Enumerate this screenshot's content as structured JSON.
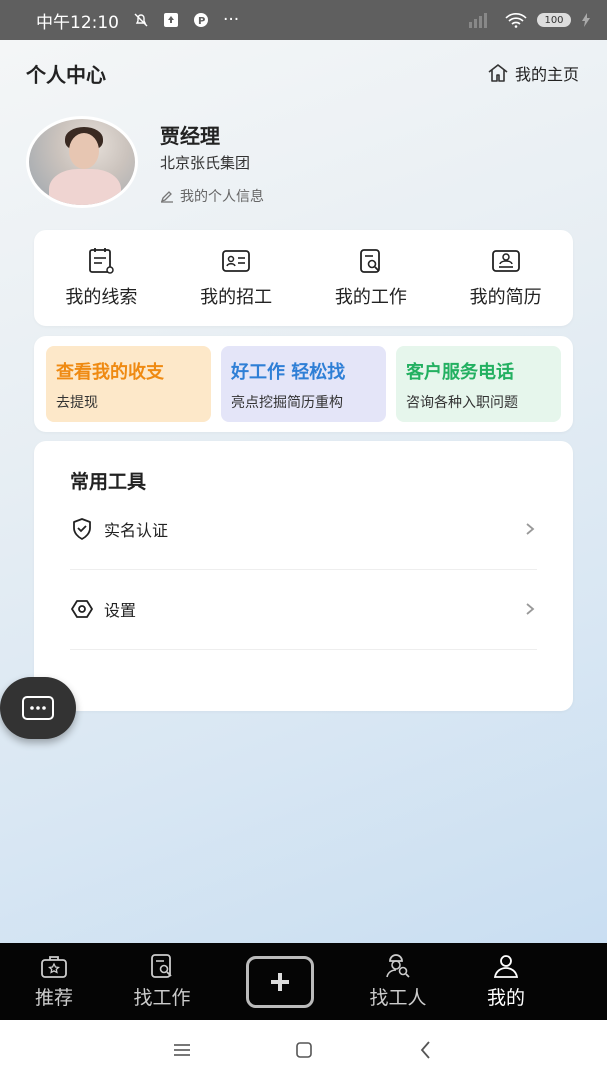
{
  "status_bar": {
    "time": "中午12:10",
    "dots": "···",
    "battery": "100"
  },
  "header": {
    "title": "个人中心",
    "home_link": "我的主页"
  },
  "profile": {
    "name": "贾经理",
    "company": "北京张氏集团",
    "edit_link": "我的个人信息"
  },
  "menu": [
    {
      "label": "我的线索",
      "icon": "clipboard-icon"
    },
    {
      "label": "我的招工",
      "icon": "id-card-icon"
    },
    {
      "label": "我的工作",
      "icon": "job-search-icon"
    },
    {
      "label": "我的简历",
      "icon": "resume-icon"
    }
  ],
  "promos": [
    {
      "title": "查看我的收支",
      "subtitle": "去提现",
      "color": "#ef8a12"
    },
    {
      "title": "好工作 轻松找",
      "subtitle": "亮点挖掘简历重构",
      "color": "#2f7fd6"
    },
    {
      "title": "客户服务电话",
      "subtitle": "咨询各种入职问题",
      "color": "#23b061"
    }
  ],
  "tools": {
    "title": "常用工具",
    "items": [
      {
        "label": "实名认证",
        "icon": "shield-check-icon"
      },
      {
        "label": "设置",
        "icon": "settings-icon"
      }
    ]
  },
  "bottom_nav": [
    {
      "label": "推荐",
      "icon": "briefcase-star-icon",
      "active": false
    },
    {
      "label": "找工作",
      "icon": "job-search-icon",
      "active": false
    },
    {
      "label": "找工人",
      "icon": "worker-search-icon",
      "active": false
    },
    {
      "label": "我的",
      "icon": "user-icon",
      "active": true
    }
  ]
}
